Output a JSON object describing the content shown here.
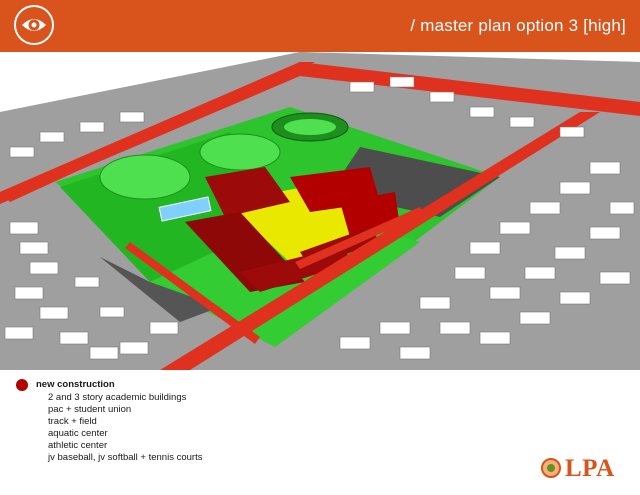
{
  "header": {
    "title": "/ master plan option 3 [high]",
    "icon": "eye-icon",
    "background": "#d9531c"
  },
  "legend": {
    "marker_color": "#b20000",
    "heading": "new construction",
    "items": [
      "2 and 3 story academic buildings",
      "pac + student union",
      "track + field",
      "aquatic center",
      "athletic center",
      "jv baseball, jv softball + tennis courts"
    ]
  },
  "logo": {
    "text": "LPA",
    "color": "#d9531c"
  },
  "colors": {
    "new_construction": "#b20000",
    "roads": "#e0301e",
    "fields": "#33cc33",
    "courtyard": "#e8e800",
    "buildings": "#ffffff",
    "parking": "#555555"
  }
}
